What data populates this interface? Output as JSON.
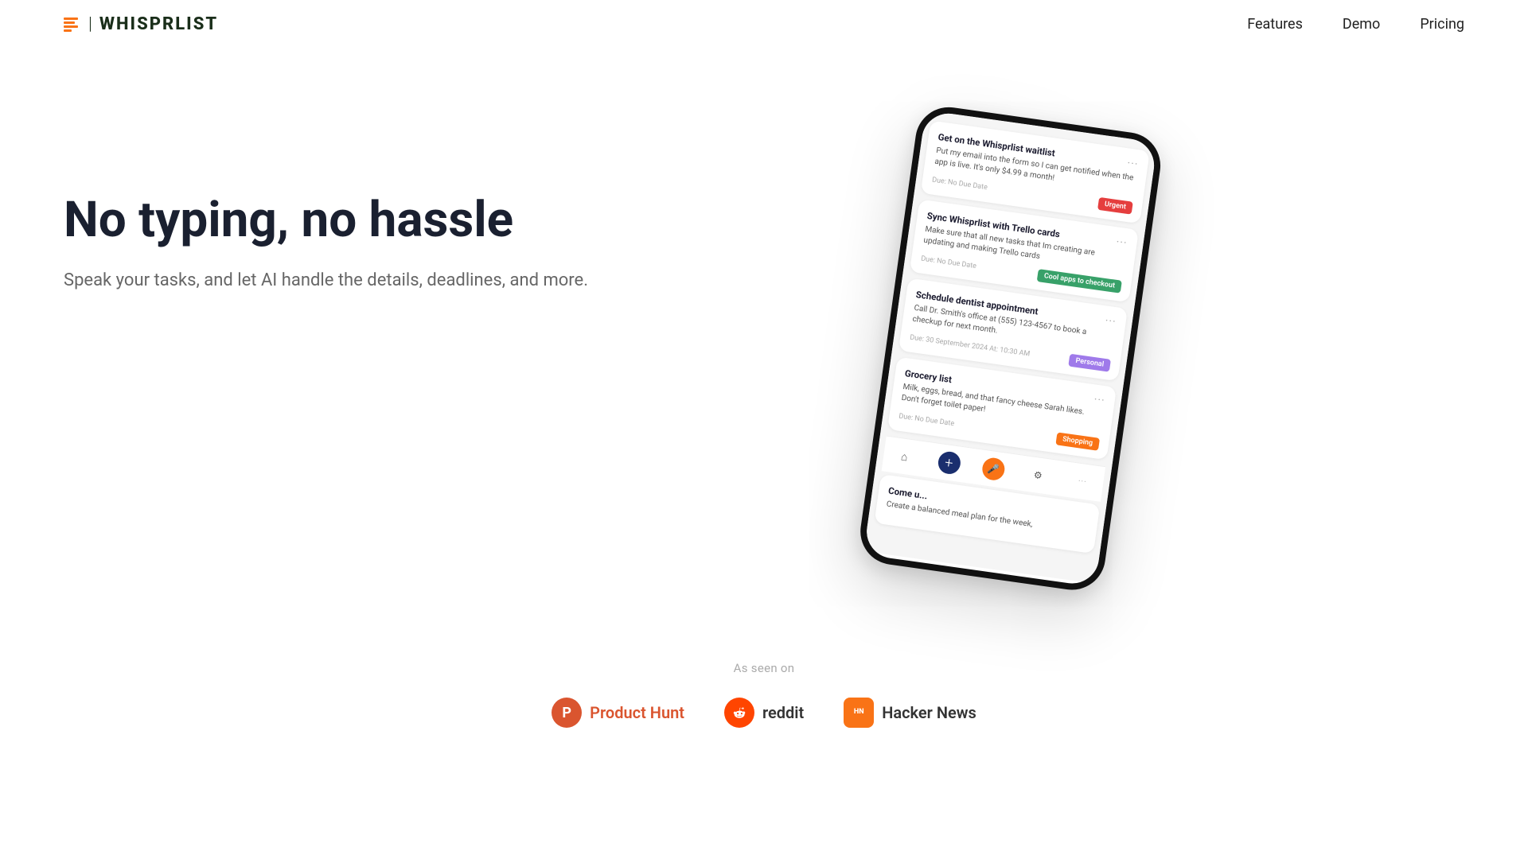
{
  "navbar": {
    "logo_text": "WHISPRLIST",
    "logo_separator": "|",
    "nav_items": [
      {
        "label": "Features",
        "id": "features"
      },
      {
        "label": "Demo",
        "id": "demo"
      },
      {
        "label": "Pricing",
        "id": "pricing"
      }
    ]
  },
  "hero": {
    "title": "No typing, no hassle",
    "subtitle": "Speak your tasks, and let AI handle the details, deadlines, and more."
  },
  "phone": {
    "tasks": [
      {
        "title": "Get on the Whisprlist waitlist",
        "body": "Put my email into the form so I can get notified when the app is live. It's only $4.99 a month!",
        "due": "Due: No Due Date",
        "badge": "Urgent",
        "badge_type": "urgent",
        "dots": "···"
      },
      {
        "title": "Sync Whisprlist with Trello cards",
        "body": "Make sure that all new tasks that Im creating are updating and making Trello cards",
        "due": "Due: No Due Date",
        "badge": "Cool apps to checkout",
        "badge_type": "cool",
        "dots": "···"
      },
      {
        "title": "Schedule dentist appointment",
        "body": "Call Dr. Smith's office at (555) 123-4567 to book a checkup for next month.",
        "due": "Due: 30 September 2024 At: 10:30 AM",
        "badge": "Personal",
        "badge_type": "personal",
        "dots": "···"
      },
      {
        "title": "Grocery list",
        "body": "Milk, eggs, bread, and that fancy cheese Sarah likes. Don't forget toilet paper!",
        "due": "Due: No Due Date",
        "badge": "Shopping",
        "badge_type": "shopping",
        "dots": "···"
      },
      {
        "title": "Come u...",
        "body": "Create a balanced meal plan for the week,",
        "due": "",
        "badge": "",
        "badge_type": "",
        "dots": ""
      }
    ],
    "bottom_bar": {
      "home": "⌂",
      "plus": "+",
      "mic": "🎤",
      "gear": "⚙",
      "more": "···"
    }
  },
  "as_seen_on": {
    "label": "As seen on",
    "brands": [
      {
        "id": "producthunt",
        "icon": "P",
        "text": "Product Hunt"
      },
      {
        "id": "reddit",
        "icon": "👽",
        "text": "reddit"
      },
      {
        "id": "hackernews",
        "line1": "HN",
        "line2": "Hacker\nNews",
        "text": "Hacker News"
      }
    ]
  }
}
